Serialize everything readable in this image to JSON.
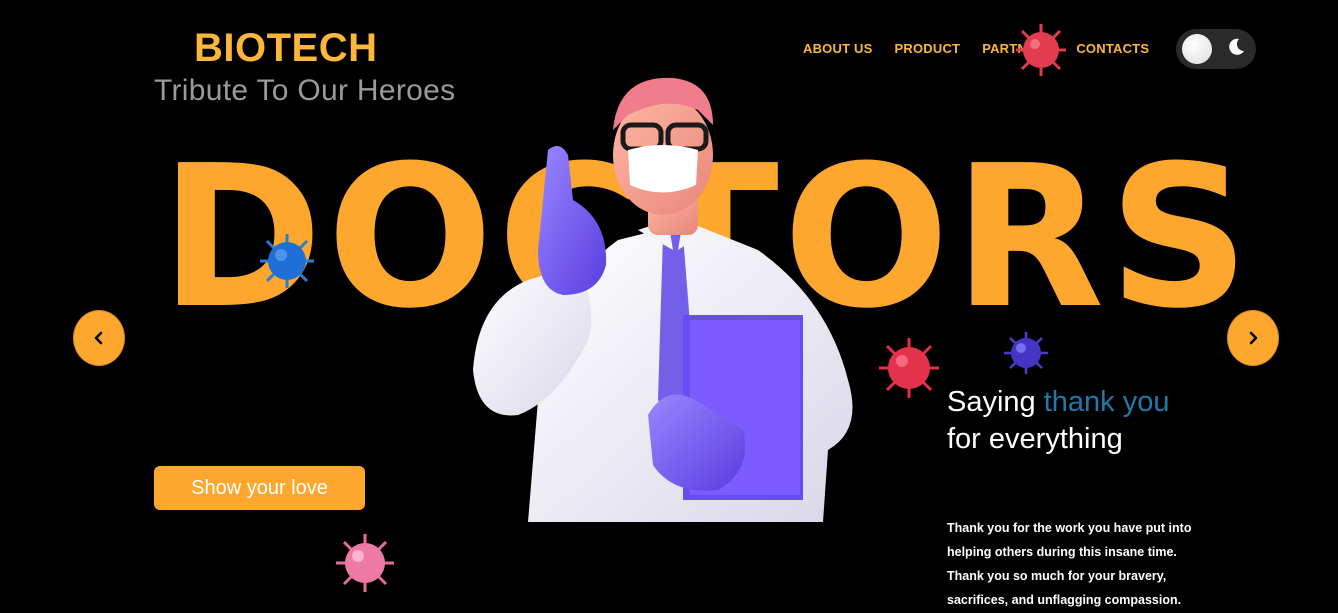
{
  "brand": {
    "title": "BIOTECH",
    "tagline": "Tribute To Our Heroes"
  },
  "nav": {
    "items": [
      "ABOUT US",
      "PRODUCT",
      "PARTNERS",
      "CONTACTS"
    ]
  },
  "theme_toggle": {
    "state": "light"
  },
  "hero": {
    "headline": "DOCTORS"
  },
  "cta": {
    "label": "Show your love"
  },
  "thanks": {
    "prefix": "Saying ",
    "highlight": "thank you",
    "suffix": "for everything"
  },
  "body_text": "Thank you for the work you have put into helping others during this insane time. Thank you so much for your bravery, sacrifices, and unflagging compassion.",
  "colors": {
    "accent": "#fea72e",
    "brand": "#fcb63a",
    "highlight": "#1f7aa8",
    "background": "#000000"
  },
  "icons": {
    "prev": "chevron-left-icon",
    "next": "chevron-right-icon",
    "moon": "moon-icon"
  }
}
